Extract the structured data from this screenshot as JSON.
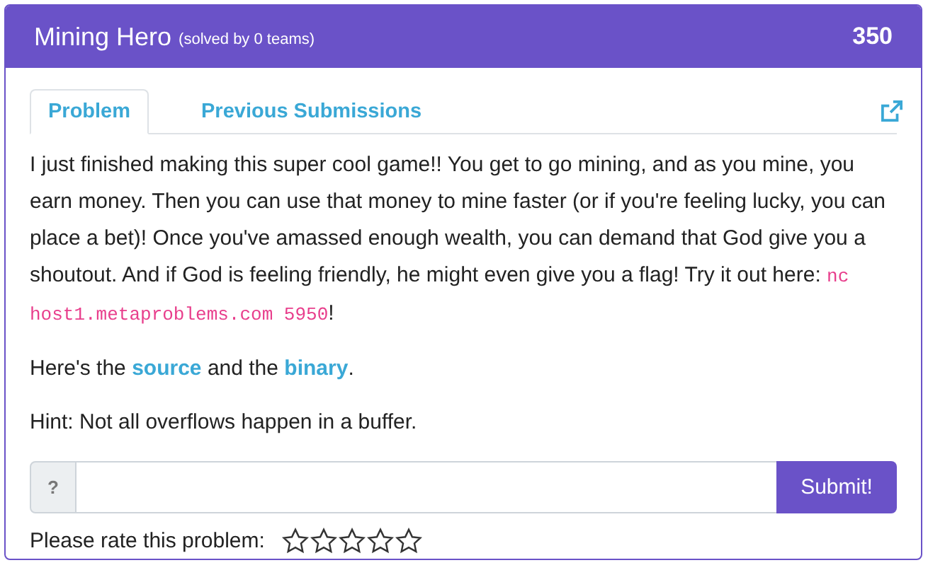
{
  "header": {
    "title": "Mining Hero",
    "solved": "(solved by 0 teams)",
    "points": "350"
  },
  "tabs": [
    {
      "label": "Problem",
      "selected": true
    },
    {
      "label": "Previous Submissions",
      "selected": false
    }
  ],
  "description": {
    "text": "I just finished making this super cool game!! You get to go mining, and as you mine, you earn money. Then you can use that money to mine faster (or if you're feeling lucky, you can place a bet)! Once you've amassed enough wealth, you can demand that God give you a shoutout. And if God is feeling friendly, he might even give you a flag! Try it out here: ",
    "command": "nc host1.metaproblems.com 5950",
    "after": "!"
  },
  "files": {
    "parts": [
      "Here's the ",
      "source",
      " and the ",
      "binary",
      "."
    ]
  },
  "hint": "Hint: Not all overflows happen in a buffer.",
  "answer": {
    "prefix": "?",
    "button": "Submit!"
  },
  "rating": {
    "label": "Please rate this problem:",
    "stars": 0
  }
}
